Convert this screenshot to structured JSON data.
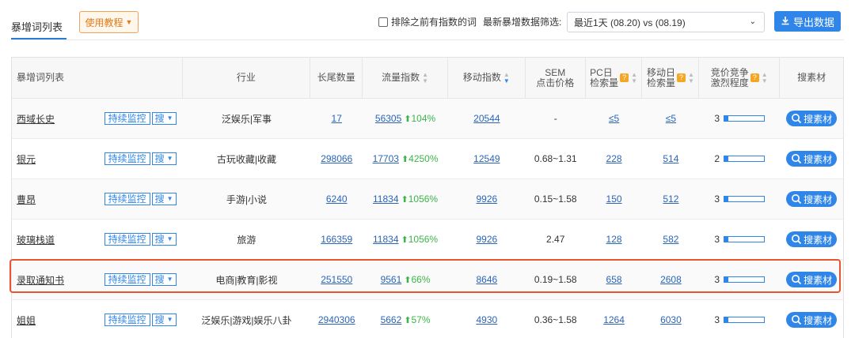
{
  "header": {
    "title": "暴增词列表",
    "tutorial_label": "使用教程",
    "exclude_label": "排除之前有指数的词",
    "filter_label": "最新暴增数据筛选:",
    "filter_value": "最近1天 (08.20) vs (08.19)",
    "export_label": "导出数据"
  },
  "columns": {
    "keyword": "暴增词列表",
    "industry": "行业",
    "longtail": "长尾数量",
    "traffic": "流量指数",
    "mobile": "移动指数",
    "sem_1": "SEM",
    "sem_2": "点击价格",
    "pc_1": "PC日",
    "pc_2": "检索量",
    "mobday_1": "移动日",
    "mobday_2": "检索量",
    "comp_1": "竞价竞争",
    "comp_2": "激烈程度",
    "material": "搜素材"
  },
  "labels": {
    "monitor": "持续监控",
    "sou": "搜",
    "material_btn": "搜素材",
    "question": "?"
  },
  "colors": {
    "accent": "#2f86e8",
    "growth": "#3bb54a",
    "highlight": "#e8552e",
    "tutorial": "#e07b1a"
  },
  "rows": [
    {
      "keyword": "西域长史",
      "industry": "泛娱乐|军事",
      "longtail": "17",
      "traffic": "56305",
      "growth": "104%",
      "mobile": "20544",
      "sem": "-",
      "pc": "≤5",
      "mobday": "≤5",
      "competition": "3",
      "comp_level": 0.1
    },
    {
      "keyword": "银元",
      "industry": "古玩收藏|收藏",
      "longtail": "298066",
      "traffic": "17703",
      "growth": "4250%",
      "mobile": "12549",
      "sem": "0.68~1.31",
      "pc": "228",
      "mobday": "514",
      "competition": "2",
      "comp_level": 0.1
    },
    {
      "keyword": "曹昂",
      "industry": "手游|小说",
      "longtail": "6240",
      "traffic": "11834",
      "growth": "1056%",
      "mobile": "9926",
      "sem": "0.15~1.58",
      "pc": "150",
      "mobday": "512",
      "competition": "3",
      "comp_level": 0.1
    },
    {
      "keyword": "玻璃栈道",
      "industry": "旅游",
      "longtail": "166359",
      "traffic": "11834",
      "growth": "1056%",
      "mobile": "9926",
      "sem": "2.47",
      "pc": "128",
      "mobday": "582",
      "competition": "3",
      "comp_level": 0.1
    },
    {
      "keyword": "录取通知书",
      "industry": "电商|教育|影视",
      "longtail": "251550",
      "traffic": "9561",
      "growth": "66%",
      "mobile": "8646",
      "sem": "0.19~1.58",
      "pc": "658",
      "mobday": "2608",
      "competition": "3",
      "comp_level": 0.1
    },
    {
      "keyword": "姐姐",
      "industry": "泛娱乐|游戏|娱乐八卦",
      "longtail": "2940306",
      "traffic": "5662",
      "growth": "57%",
      "mobile": "4930",
      "sem": "0.36~1.58",
      "pc": "1264",
      "mobday": "6030",
      "competition": "3",
      "comp_level": 0.1
    }
  ]
}
